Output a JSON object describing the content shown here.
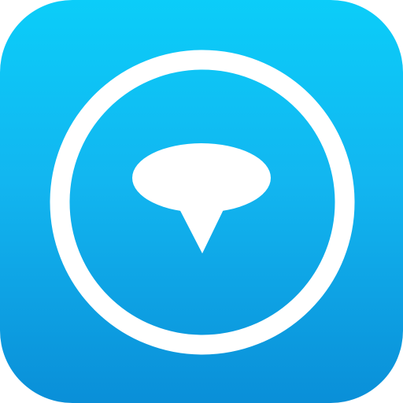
{
  "icon": {
    "name": "app-icon",
    "symbol": "location-pin-icon",
    "colors": {
      "background_top": "#0bcdf9",
      "background_bottom": "#0a8fd8",
      "foreground": "#ffffff"
    }
  }
}
